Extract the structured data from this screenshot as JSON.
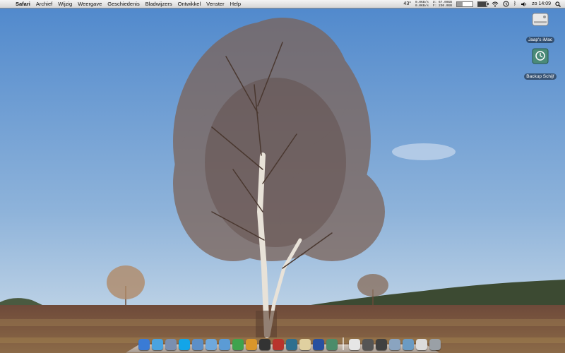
{
  "menubar": {
    "app_name": "Safari",
    "menus": [
      "Archief",
      "Wijzig",
      "Weergave",
      "Geschiedenis",
      "Bladwijzers",
      "Ontwikkel",
      "Venster",
      "Help"
    ],
    "temperature": "43°",
    "net_down": "0.0KB/s",
    "net_up": "0.0KB/s",
    "disk_used": "U: 67.00GB",
    "disk_free": "F: 230.0GB",
    "memory_used_fraction": 0.35,
    "battery_fraction": 0.9,
    "clock": "zo 14:09"
  },
  "desktop": {
    "icons": [
      {
        "label": "Jaap's iMac",
        "icon": "hard-drive-icon"
      },
      {
        "label": "Backup Schijf",
        "icon": "time-machine-drive-icon"
      }
    ]
  },
  "dock": {
    "apps": [
      {
        "icon": "finder-icon",
        "color": "#3a7bd5"
      },
      {
        "icon": "safari-icon",
        "color": "#4aa3df"
      },
      {
        "icon": "preview-icon",
        "color": "#7a8fb0"
      },
      {
        "icon": "skype-icon",
        "color": "#12a5e8"
      },
      {
        "icon": "contacts-icon",
        "color": "#5c8fc7"
      },
      {
        "icon": "ichat-icon",
        "color": "#6fa8dc"
      },
      {
        "icon": "itunes-icon",
        "color": "#5b9bd5"
      },
      {
        "icon": "app-green-icon",
        "color": "#3fa34d"
      },
      {
        "icon": "iphoto-icon",
        "color": "#d9962b"
      },
      {
        "icon": "dvd-player-icon",
        "color": "#333333"
      },
      {
        "icon": "photo-booth-icon",
        "color": "#b8332c"
      },
      {
        "icon": "time-machine-icon",
        "color": "#2f6f8f"
      },
      {
        "icon": "app-cream-icon",
        "color": "#e0d0a0"
      },
      {
        "icon": "app-globe-icon",
        "color": "#2850a0"
      },
      {
        "icon": "app-map-icon",
        "color": "#4c8c6a"
      }
    ],
    "stacks": [
      {
        "icon": "document-icon",
        "color": "#e6e6e6"
      },
      {
        "icon": "calculator-icon",
        "color": "#555555"
      },
      {
        "icon": "folder-dark-icon",
        "color": "#404040"
      },
      {
        "icon": "screenshot-icon",
        "color": "#8aa4c0"
      },
      {
        "icon": "picture-icon",
        "color": "#6b9bc3"
      },
      {
        "icon": "documents-stack-icon",
        "color": "#dcdcdc"
      },
      {
        "icon": "trash-icon",
        "color": "#9aa0a6"
      }
    ]
  }
}
